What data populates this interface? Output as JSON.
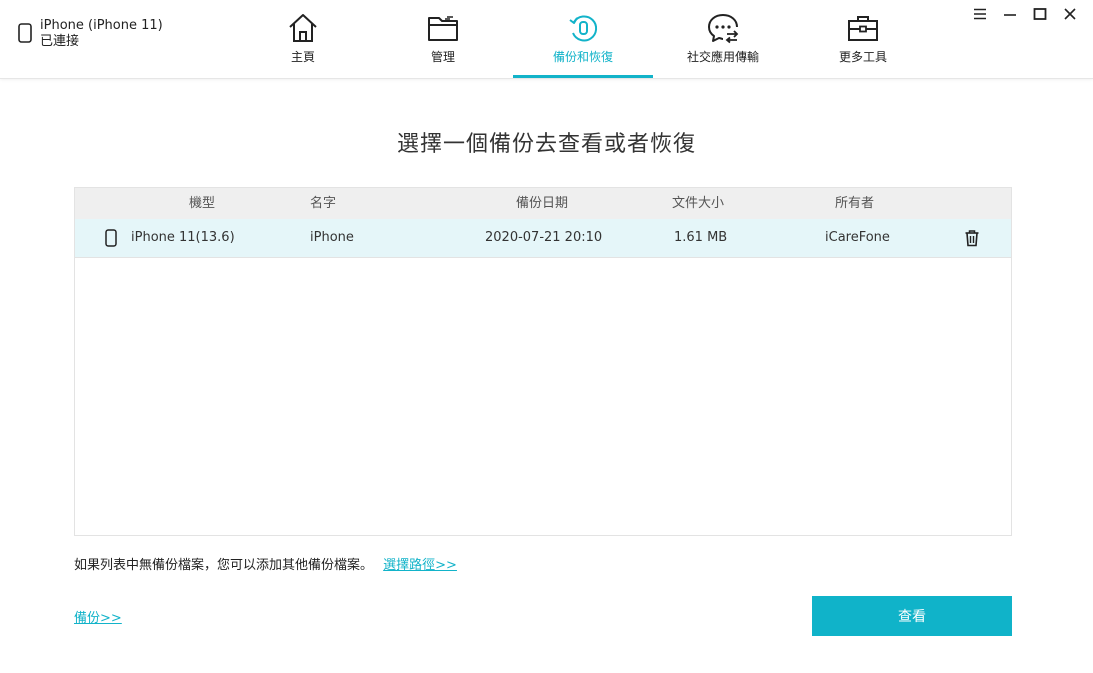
{
  "device": {
    "name": "iPhone (iPhone 11)",
    "status": "已連接"
  },
  "nav": {
    "home": "主頁",
    "manage": "管理",
    "backup_restore": "備份和恢復",
    "social_transfer": "社交應用傳輸",
    "more_tools": "更多工具",
    "active": "backup_restore"
  },
  "page": {
    "title": "選擇一個備份去查看或者恢復"
  },
  "table": {
    "headers": {
      "model": "機型",
      "name": "名字",
      "date": "備份日期",
      "size": "文件大小",
      "owner": "所有者"
    },
    "rows": [
      {
        "model": "iPhone 11(13.6)",
        "name": "iPhone",
        "date": "2020-07-21 20:10",
        "size": "1.61 MB",
        "owner": "iCareFone"
      }
    ]
  },
  "hint": {
    "text": "如果列表中無備份檔案，您可以添加其他備份檔案。",
    "link": "選擇路徑>>"
  },
  "backup_link": "備份>>",
  "view_button": "查看",
  "colors": {
    "accent": "#12b3c9",
    "row_highlight": "#e5f6f9",
    "header_bg": "#efefef"
  }
}
